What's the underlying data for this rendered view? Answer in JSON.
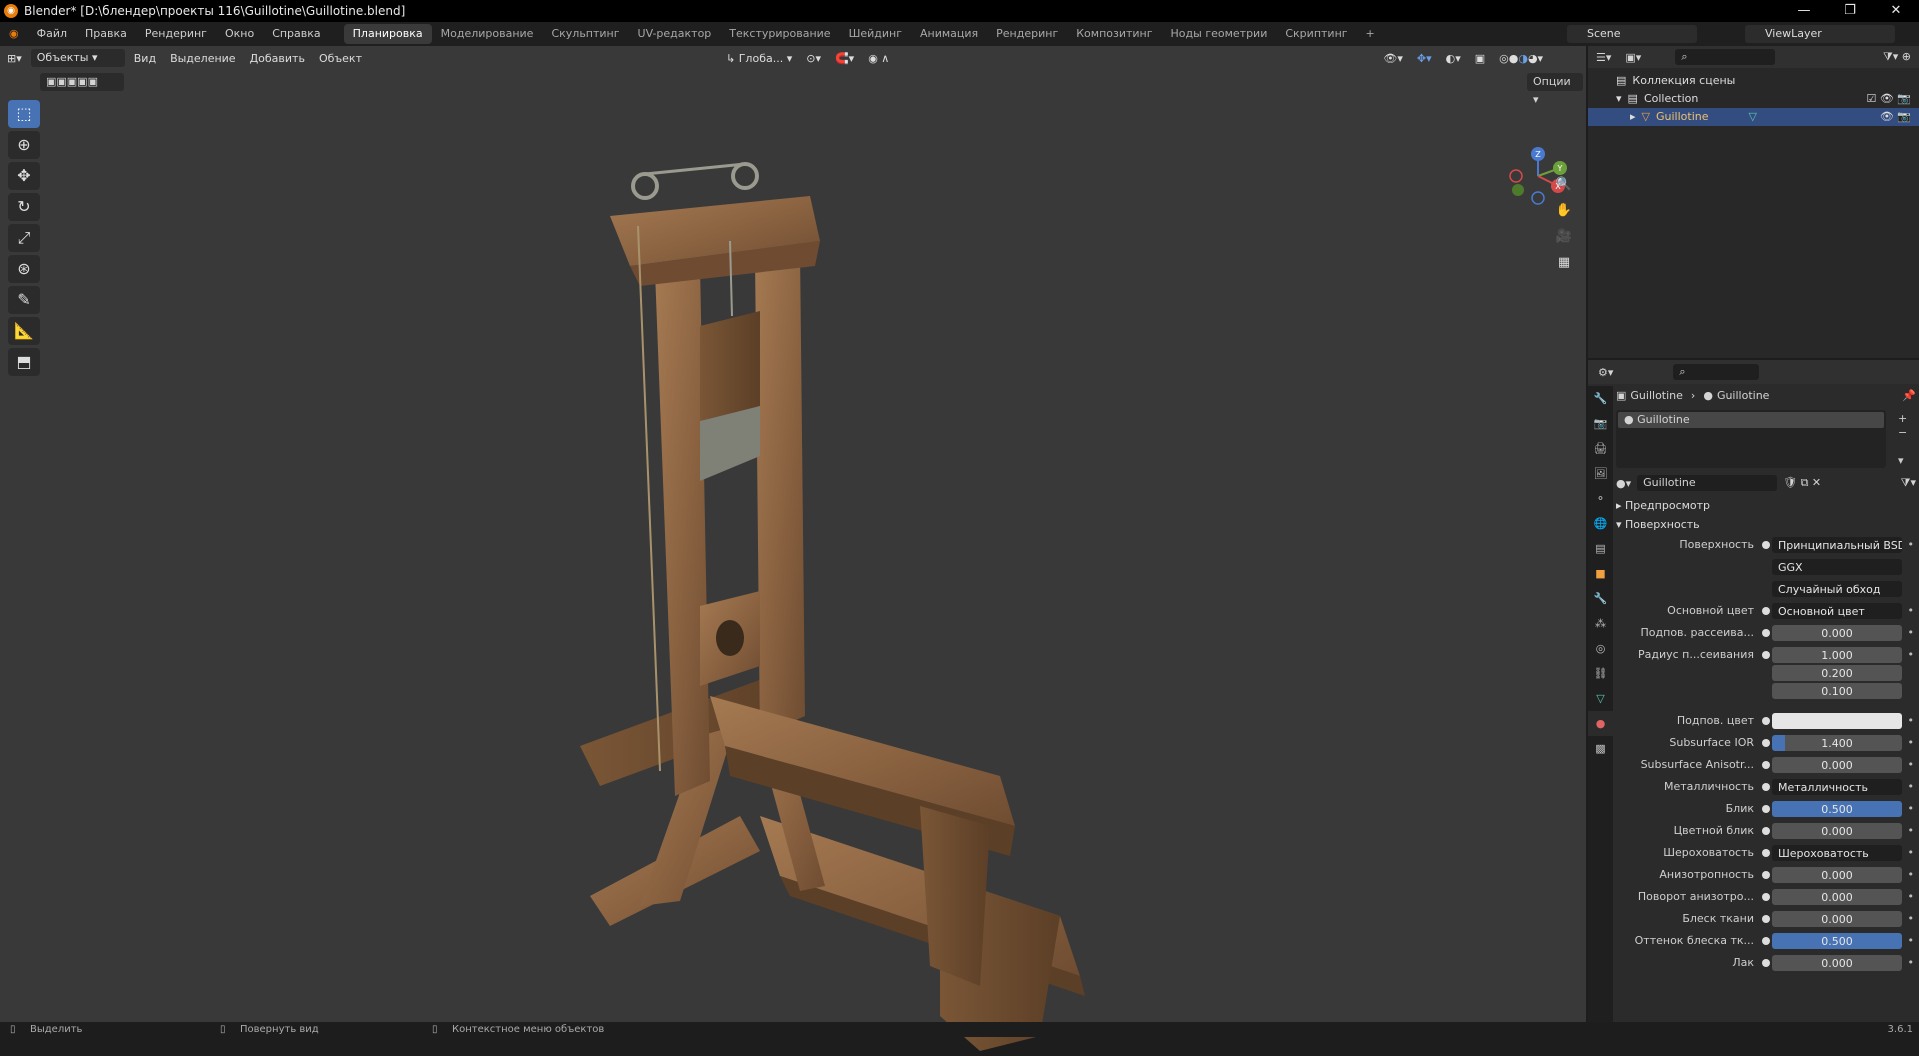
{
  "window": {
    "title": "Blender* [D:\\блендер\\проекты 116\\Guillotine\\Guillotine.blend]"
  },
  "menus": [
    "Файл",
    "Правка",
    "Рендеринг",
    "Окно",
    "Справка"
  ],
  "workspaces": [
    "Планировка",
    "Моделирование",
    "Скульптинг",
    "UV-редактор",
    "Текстурирование",
    "Шейдинг",
    "Анимация",
    "Рендеринг",
    "Композитинг",
    "Ноды геометрии",
    "Скриптинг",
    "+"
  ],
  "scene": {
    "scene_name": "Scene",
    "view_layer": "ViewLayer"
  },
  "viewport": {
    "mode": "Объекты",
    "menu": [
      "Вид",
      "Выделение",
      "Добавить",
      "Объект"
    ],
    "orientation": "Глоба...",
    "options": "Опции",
    "gizmo": {
      "x": "X",
      "y": "Y",
      "z": "Z"
    }
  },
  "outliner": {
    "title": "Коллекция сцены",
    "collection": "Collection",
    "object": "Guillotine"
  },
  "properties": {
    "breadcrumb_object": "Guillotine",
    "breadcrumb_material": "Guillotine",
    "slot": "Guillotine",
    "material_name": "Guillotine",
    "preview_label": "Предпросмотр",
    "surface_label": "Поверхность",
    "rows": [
      {
        "label": "Поверхность",
        "value": "Принципиальный BSDF",
        "kind": "link"
      },
      {
        "label": "",
        "value": "GGX",
        "kind": "dropdown"
      },
      {
        "label": "",
        "value": "Случайный обход",
        "kind": "dropdown"
      },
      {
        "label": "Основной цвет",
        "value": "Основной цвет",
        "kind": "link"
      },
      {
        "label": "Подпов. рассеива...",
        "value": "0.000",
        "kind": "num"
      },
      {
        "label": "Радиус п...сеивания",
        "value": "1.000",
        "kind": "num"
      },
      {
        "label": "",
        "value": "0.200",
        "kind": "num"
      },
      {
        "label": "",
        "value": "0.100",
        "kind": "num"
      },
      {
        "label": "Подпов. цвет",
        "value": "",
        "kind": "color"
      },
      {
        "label": "Subsurface IOR",
        "value": "1.400",
        "kind": "partial"
      },
      {
        "label": "Subsurface Anisotr...",
        "value": "0.000",
        "kind": "num"
      },
      {
        "label": "Металличность",
        "value": "Металличность",
        "kind": "link"
      },
      {
        "label": "Блик",
        "value": "0.500",
        "kind": "blue"
      },
      {
        "label": "Цветной блик",
        "value": "0.000",
        "kind": "num"
      },
      {
        "label": "Шероховатость",
        "value": "Шероховатость",
        "kind": "link"
      },
      {
        "label": "Анизотропность",
        "value": "0.000",
        "kind": "num"
      },
      {
        "label": "Поворот анизотро...",
        "value": "0.000",
        "kind": "num"
      },
      {
        "label": "Блеск ткани",
        "value": "0.000",
        "kind": "num"
      },
      {
        "label": "Оттенок блеска тк...",
        "value": "0.500",
        "kind": "blue"
      },
      {
        "label": "Лак",
        "value": "0.000",
        "kind": "num"
      }
    ]
  },
  "status": {
    "select": "Выделить",
    "rotate": "Повернуть вид",
    "context": "Контекстное меню объектов",
    "version": "3.6.1"
  }
}
